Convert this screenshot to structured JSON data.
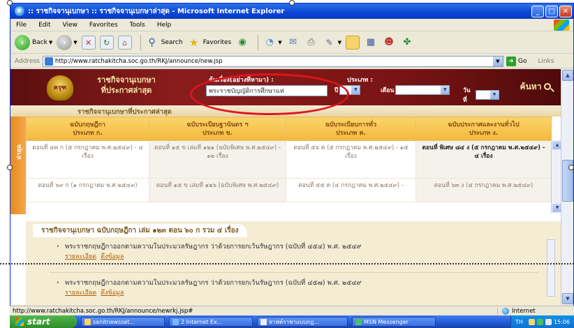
{
  "window": {
    "title": ":: ราชกิจจานุเบกษา :: ราชกิจจานุเบกษาล่าสุด - Microsoft Internet Explorer",
    "minimize": "_",
    "maximize": "□",
    "close": "✕"
  },
  "menu": [
    "File",
    "Edit",
    "View",
    "Favorites",
    "Tools",
    "Help"
  ],
  "toolbar": {
    "back_label": "Back",
    "search_label": "Search",
    "favorites_label": "Favorites"
  },
  "address": {
    "label": "Address",
    "url": "http://www.ratchakitcha.soc.go.th/RKJ/announce/new.jsp",
    "go_label": "Go",
    "links_label": "Links"
  },
  "site": {
    "title_line1": "ราชกิจจานุเบกษา",
    "title_line2": "ที่ประกาศล่าสุด",
    "emblem": "ครุฑ",
    "search": {
      "keyword_label": "ค้นเรื่อง(อย่างที่หามา) :",
      "keyword_value": "พระราชบัญญัติการศึกษาแห่",
      "type_label": "ประเภท :",
      "year_label": "ปี",
      "month_label": "เดือน",
      "day_label": "วันที่",
      "button_label": "ค้นหา"
    }
  },
  "section": {
    "title": "ราชกิจจานุเบกษาที่ประกาศล่าสุด",
    "side_tab": "ล่าสุด"
  },
  "table": {
    "columns": [
      "ฉบับกฤษฎีกา\nประเภท ก.",
      "ฉบับระเบียบฐานันดร ฯ\nประเภท ข.",
      "ฉบับระเบียบการทั่ว\nประเภท ค.",
      "ฉบับประกาศและงานทั่วไป\nประเภท ง."
    ],
    "rows": [
      [
        "ตอนที่ ๔๓ ก (๕ กรกฎาคม พ.ศ.๒๕๔๙) - ๔ เรื่อง",
        "ตอนที่ ๑๕ ข เล่มที่ ๑๒๑ (ฉบับพิเศษ พ.ศ.๒๕๔๙) - ๑๒ เรื่อง",
        "ตอนที่ ๕๖ ค (๕ กรกฎาคม พ.ศ.๒๕๔๙) - ๑๕ เรื่อง",
        "ตอนที่ พิเศษ ๘๔ ง (๕ กรกฎาคม พ.ศ.๒๕๔๙) - ๔ เรื่อง"
      ],
      [
        "ตอนที่ ๖๙ ก (๑ กรกฎาคม พ.ศ.๒๕๔๙)",
        "ตอนที่ ๑๕ ข เล่มที่ ๑๒๖ (ฉบับพิเศษ พ.ศ.๒๕๔๙)",
        "ตอนที่ ๕๕ ค (๔ กรกฎาคม พ.ศ.๒๕๔๙) -",
        "ตอนที่ ๖๓ ง (๕ กรกฎาคม พ.ศ.๒๕๔๙)"
      ]
    ]
  },
  "lower": {
    "title": "ราชกิจจานุเบกษา ฉบับกฤษฎีกา เล่ม ๑๒๓ ตอน ๖๐ ก รวม ๔ เรื่อง",
    "items": [
      {
        "text": "พระราชกฤษฎีกาออกตามความในประมวลรัษฎากร ว่าด้วยการยกเว้นรัษฎากร (ฉบับที่ ๔๕๔) พ.ศ. ๒๕๔๙",
        "detail_link": "รายละเอียด",
        "download_link": "ดึงข้อมูล"
      },
      {
        "text": "พระราชกฤษฎีกาออกตามความในประมวลรัษฎากร ว่าด้วยการยกเว้นรัษฎากร (ฉบับที่ ๔๕๗) พ.ศ. ๒๕๔๙",
        "detail_link": "รายละเอียด",
        "download_link": "ดึงข้อมูล"
      }
    ]
  },
  "status": {
    "url": "http://www.ratchakitcha.soc.go.th/RKJ/announce/newrkj.jsp#",
    "zone": "Internet"
  },
  "taskbar": {
    "start": "start",
    "tasks": [
      "sanitnewsset...",
      "2 Internet Ex...",
      "ลาฟต์ราชาแบบกฎ...",
      "MSN Messenger"
    ],
    "tray_lang": "TH",
    "clock": "15:06"
  },
  "colors": {
    "header_red": "#8a1c1c",
    "table_header": "#f2b83e",
    "annotation": "#e0141c"
  },
  "icons": [
    "ie-logo-icon",
    "back-icon",
    "forward-icon",
    "stop-icon",
    "refresh-icon",
    "home-icon",
    "search-icon",
    "favorites-icon",
    "media-icon",
    "history-icon",
    "mail-icon",
    "print-icon",
    "edit-icon",
    "folder-icon",
    "messenger-icon",
    "go-icon",
    "magnifier-icon",
    "globe-icon"
  ]
}
